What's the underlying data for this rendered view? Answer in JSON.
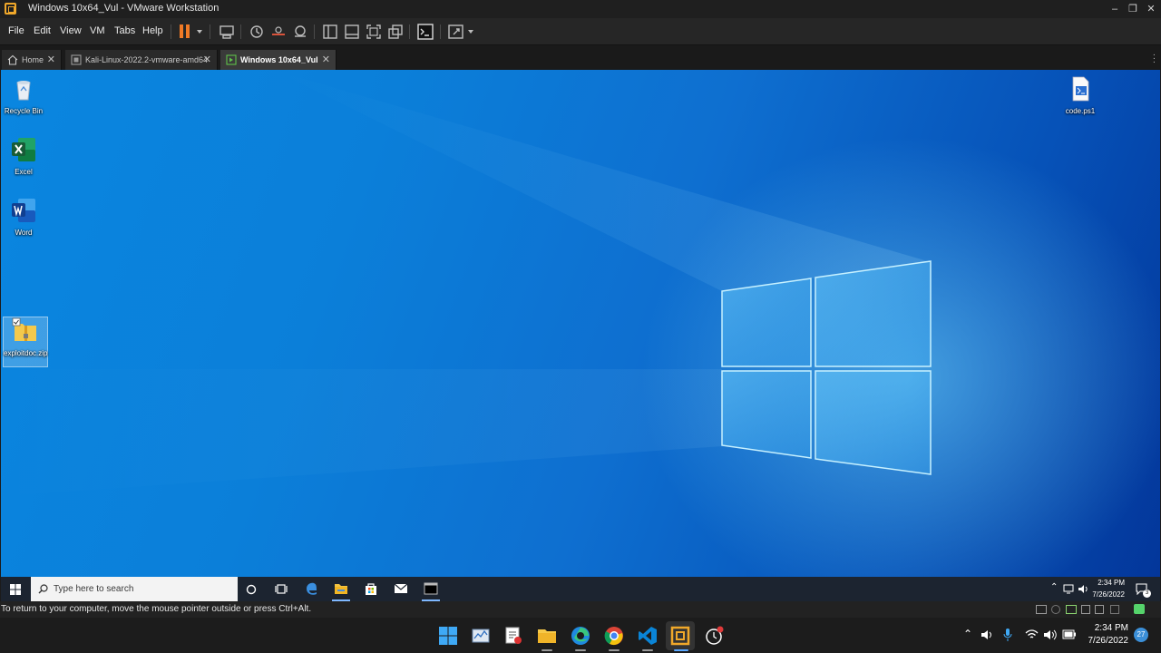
{
  "window": {
    "title": "Windows 10x64_Vul - VMware Workstation"
  },
  "menu": [
    "File",
    "Edit",
    "View",
    "VM",
    "Tabs",
    "Help"
  ],
  "tabs": [
    {
      "label": "Home",
      "active": false
    },
    {
      "label": "Kali-Linux-2022.2-vmware-amd64",
      "active": false
    },
    {
      "label": "Windows 10x64_Vul",
      "active": true
    }
  ],
  "desktop_icons": [
    {
      "label": "Recycle Bin",
      "icon": "recycle-bin-icon"
    },
    {
      "label": "Excel",
      "icon": "excel-icon"
    },
    {
      "label": "Word",
      "icon": "word-icon"
    },
    {
      "label": "exploitdoc.zip",
      "icon": "zip-folder-icon"
    },
    {
      "label": "code.ps1",
      "icon": "powershell-file-icon"
    }
  ],
  "guest_taskbar": {
    "search_placeholder": "Type here to search",
    "time": "2:34 PM",
    "date": "7/26/2022",
    "notifications": "3"
  },
  "status_message": "To return to your computer, move the mouse pointer outside or press Ctrl+Alt.",
  "host_taskbar": {
    "time": "2:34 PM",
    "date": "7/26/2022",
    "notification_count": "27"
  },
  "colors": {
    "accent": "#f07a26",
    "desktop_blue": "#0a7ad6",
    "taskbar": "#1c2430"
  }
}
